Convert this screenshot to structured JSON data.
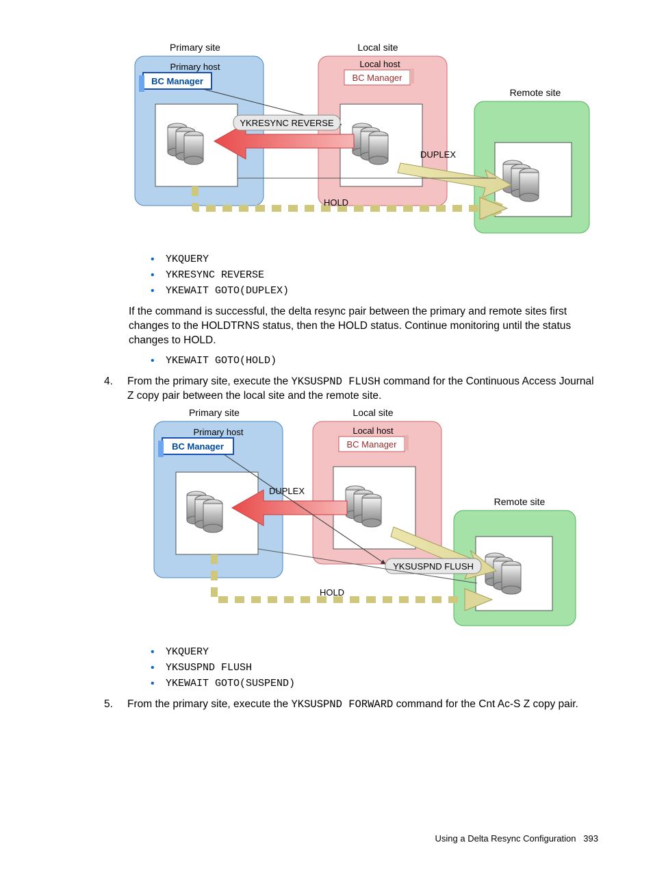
{
  "diagram1": {
    "primarySite": "Primary site",
    "primaryHost": "Primary host",
    "bcPrimary": "BC Manager",
    "localSite": "Local site",
    "localHost": "Local host",
    "bcLocal": "BC Manager",
    "remoteSite": "Remote site",
    "cmd": "YKRESYNC REVERSE",
    "duplex": "DUPLEX",
    "hold": "HOLD"
  },
  "bullets1": {
    "b1": "YKQUERY",
    "b2": "YKRESYNC REVERSE",
    "b3": "YKEWAIT GOTO(DUPLEX)"
  },
  "para1": "If the command is successful, the delta resync pair between the primary and remote sites first changes to the HOLDTRNS status, then the HOLD status. Continue monitoring until the status changes to HOLD.",
  "bullets2": {
    "b1": "YKEWAIT GOTO(HOLD)"
  },
  "step4": {
    "num": "4.",
    "prefix": "From the primary site, execute the ",
    "cmd": "YKSUSPND FLUSH",
    "suffix": " command for the Continuous Access Journal Z copy pair between the local site and the remote site."
  },
  "diagram2": {
    "primarySite": "Primary site",
    "primaryHost": "Primary host",
    "bcPrimary": "BC Manager",
    "localSite": "Local site",
    "localHost": "Local host",
    "bcLocal": "BC Manager",
    "remoteSite": "Remote site",
    "duplex": "DUPLEX",
    "cmd": "YKSUSPND FLUSH",
    "hold": "HOLD"
  },
  "bullets3": {
    "b1": "YKQUERY",
    "b2": "YKSUSPND FLUSH",
    "b3": "YKEWAIT GOTO(SUSPEND)"
  },
  "step5": {
    "num": "5.",
    "prefix": "From the primary site, execute the ",
    "cmd": "YKSUSPND FORWARD",
    "suffix": " command for the Cnt Ac-S Z copy pair."
  },
  "footer": {
    "text": "Using a Delta Resync Configuration",
    "page": "393"
  }
}
